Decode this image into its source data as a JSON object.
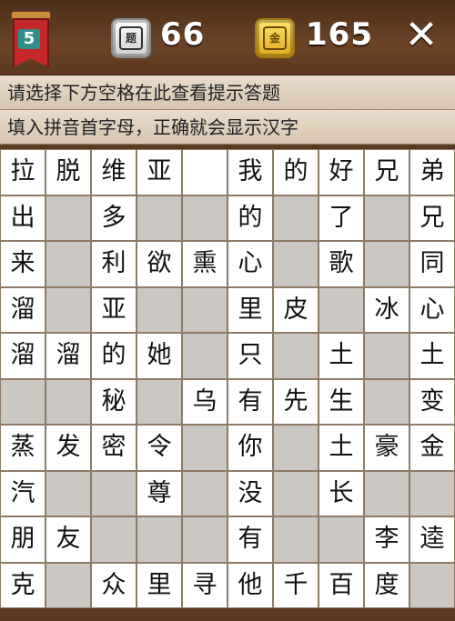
{
  "header": {
    "level": "5",
    "questions_icon_label": "题",
    "questions_count": "66",
    "gold_icon_label": "金",
    "gold_count": "165",
    "close_label": "✕"
  },
  "hints": [
    "请选择下方空格在此查看提示答题",
    "填入拼音首字母，正确就会显示汉字"
  ],
  "grid": [
    [
      "拉",
      "脱",
      "维",
      "亚",
      "",
      "我",
      "的",
      "好",
      "兄",
      "弟"
    ],
    [
      "出",
      null,
      "多",
      null,
      null,
      "的",
      null,
      "了",
      null,
      "兄"
    ],
    [
      "来",
      null,
      "利",
      "欲",
      "熏",
      "心",
      null,
      "歌",
      null,
      "同"
    ],
    [
      "溜",
      null,
      "亚",
      null,
      null,
      "里",
      "皮",
      null,
      "冰",
      "心"
    ],
    [
      "溜",
      "溜",
      "的",
      "她",
      null,
      "只",
      null,
      "土",
      null,
      "土"
    ],
    [
      null,
      null,
      "秘",
      null,
      "乌",
      "有",
      "先",
      "生",
      null,
      "变"
    ],
    [
      "蒸",
      "发",
      "密",
      "令",
      null,
      "你",
      null,
      "土",
      "豪",
      "金"
    ],
    [
      "汽",
      null,
      null,
      "尊",
      null,
      "没",
      null,
      "长",
      null,
      null
    ],
    [
      "朋",
      "友",
      null,
      null,
      null,
      "有",
      null,
      null,
      "李",
      "逵"
    ],
    [
      "克",
      null,
      "众",
      "里",
      "寻",
      "他",
      "千",
      "百",
      "度",
      null
    ]
  ]
}
